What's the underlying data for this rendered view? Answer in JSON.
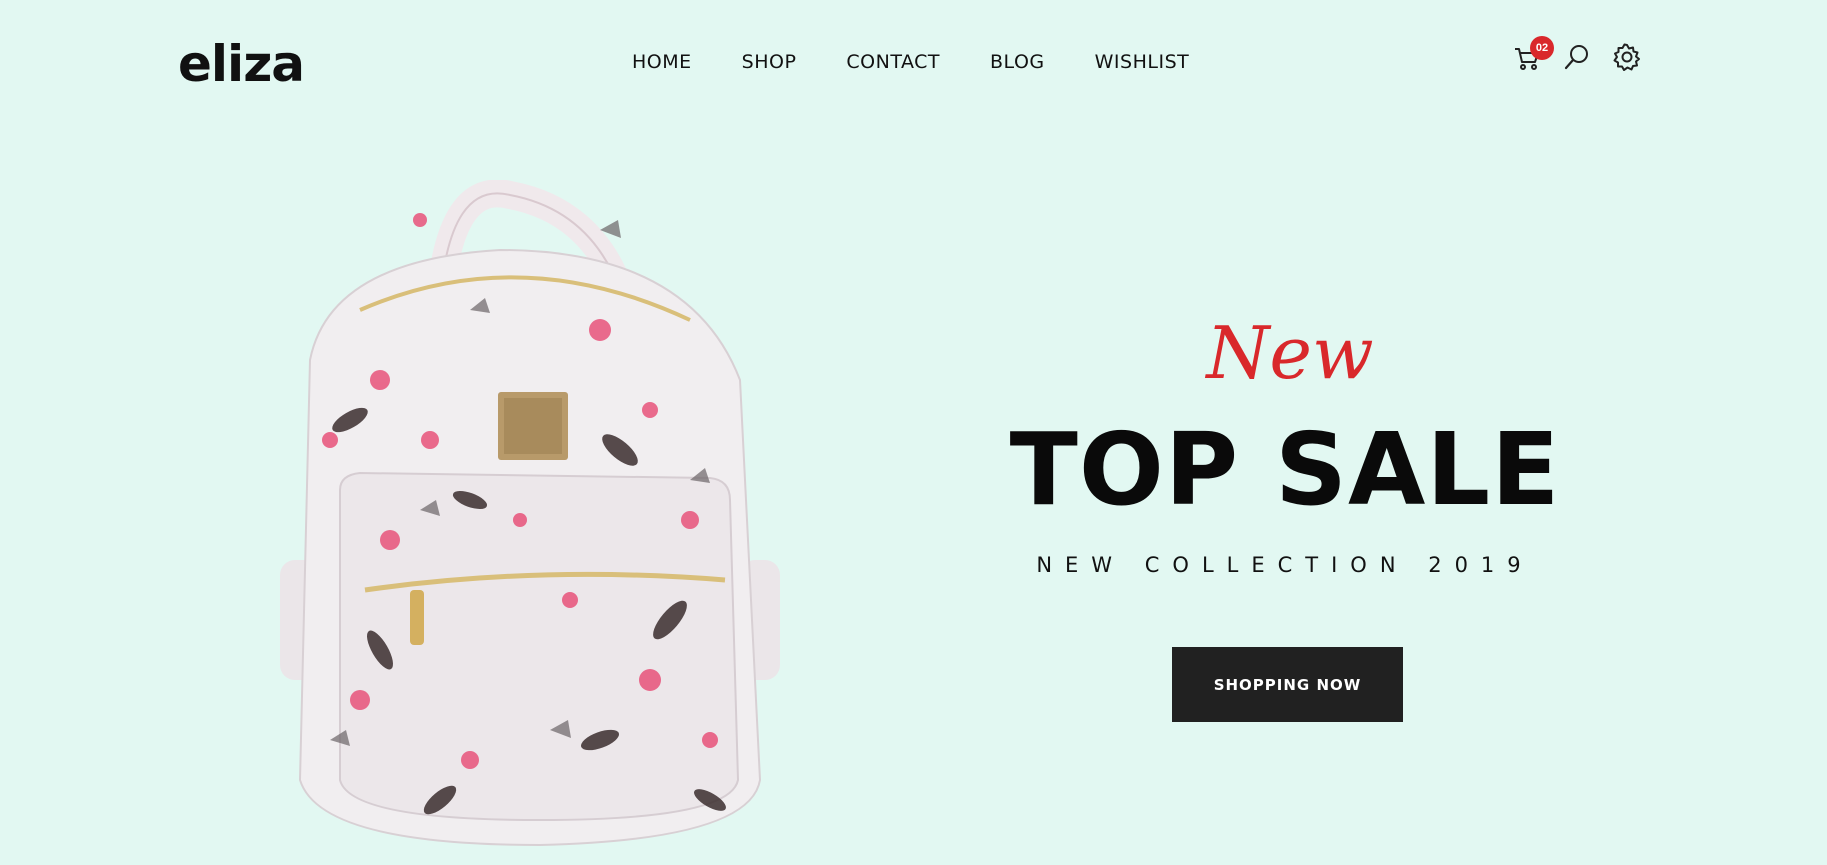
{
  "brand": {
    "logo": "eliza"
  },
  "nav": {
    "items": [
      {
        "label": "HOME"
      },
      {
        "label": "SHOP"
      },
      {
        "label": "CONTACT"
      },
      {
        "label": "BLOG"
      },
      {
        "label": "WISHLIST"
      }
    ]
  },
  "header_icons": {
    "cart": {
      "icon": "cart-icon",
      "count": "02"
    },
    "search": {
      "icon": "search-icon"
    },
    "settings": {
      "icon": "gear-icon"
    }
  },
  "hero": {
    "script_word": "New",
    "title": "TOP SALE",
    "subtitle": "NEW COLLECTION 2019",
    "cta_label": "SHOPPING NOW",
    "product_image": "floral-backpack",
    "accent_color": "#d9282b",
    "background_color": "#e2f8f2",
    "button_color": "#212121"
  }
}
